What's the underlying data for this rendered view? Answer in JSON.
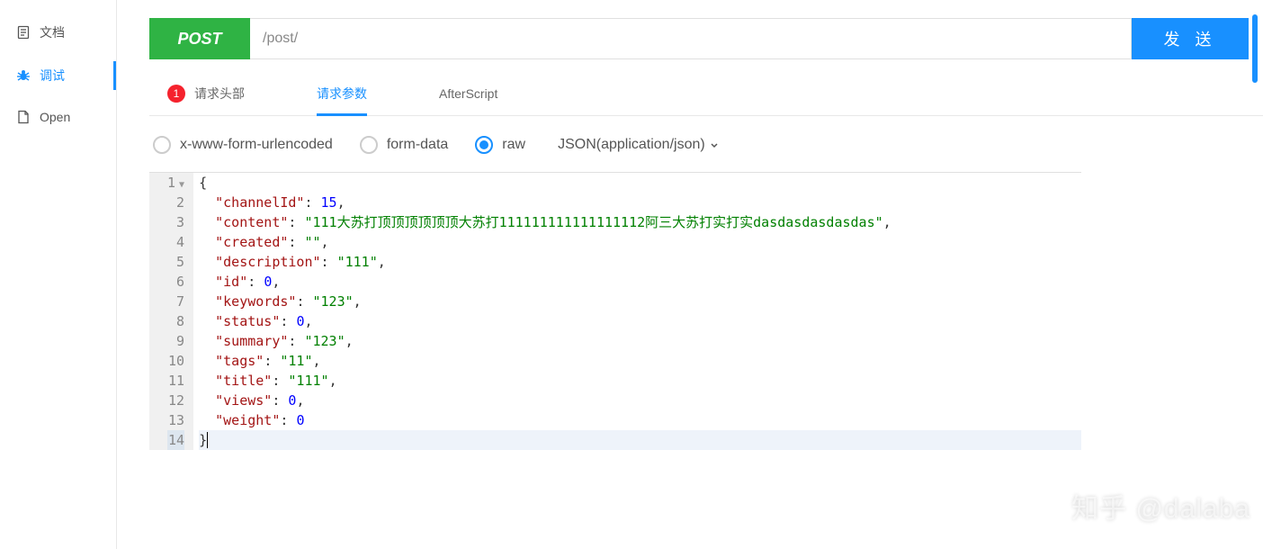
{
  "sidebar": {
    "items": [
      {
        "label": "文档",
        "icon": "doc"
      },
      {
        "label": "调试",
        "icon": "bug",
        "active": true
      },
      {
        "label": "Open",
        "icon": "file"
      }
    ]
  },
  "request": {
    "method": "POST",
    "url": "/post/",
    "send": "发 送"
  },
  "tabs": {
    "items": [
      {
        "label": "请求头部",
        "badge": "1"
      },
      {
        "label": "请求参数",
        "active": true
      },
      {
        "label": "AfterScript"
      }
    ]
  },
  "body_types": {
    "options": [
      {
        "label": "x-www-form-urlencoded"
      },
      {
        "label": "form-data"
      },
      {
        "label": "raw",
        "checked": true
      }
    ],
    "content_type": "JSON(application/json)"
  },
  "editor": {
    "line_numbers": [
      "1",
      "2",
      "3",
      "4",
      "5",
      "6",
      "7",
      "8",
      "9",
      "10",
      "11",
      "12",
      "13",
      "14"
    ],
    "payload": {
      "channelId": 15,
      "content": "111大苏打顶顶顶顶顶顶大苏打111111111111111112阿三大苏打实打实dasdasdasdasdas",
      "created": "",
      "description": "111",
      "id": 0,
      "keywords": "123",
      "status": 0,
      "summary": "123",
      "tags": "11",
      "title": "111",
      "views": 0,
      "weight": 0
    }
  },
  "watermark": "知乎 @dalaba"
}
